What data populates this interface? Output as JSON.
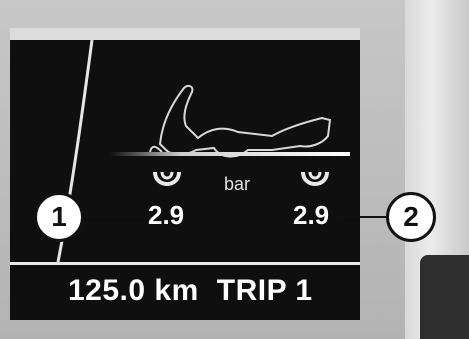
{
  "display": {
    "unit": "bar",
    "front_pressure": "2.9",
    "rear_pressure": "2.9",
    "odometer": "125.0 km",
    "trip_label": "TRIP 1"
  },
  "callouts": {
    "left": "1",
    "right": "2"
  },
  "icons": {
    "tire": "tire-icon",
    "motorcycle": "motorcycle-silhouette-icon"
  },
  "colors": {
    "screen_bg": "#0f0f0f",
    "display_text": "#ffffff",
    "bezel": "#bdbdbd"
  }
}
